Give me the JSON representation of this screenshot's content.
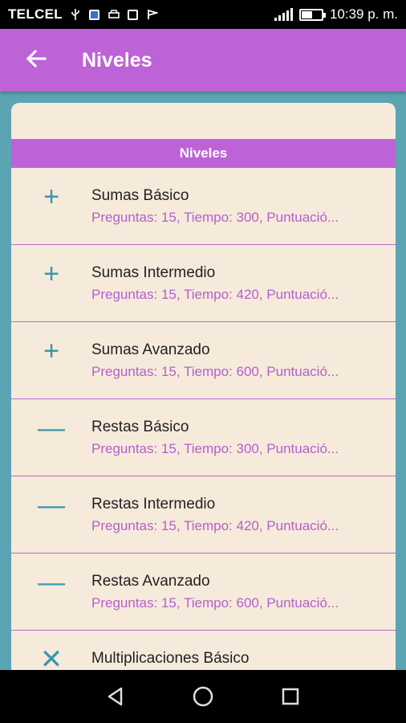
{
  "status_bar": {
    "carrier": "TELCEL",
    "time": "10:39 p. m.",
    "battery_level": 0.55
  },
  "app_bar": {
    "title": "Niveles",
    "back_icon": "arrow-back-icon"
  },
  "section": {
    "header": "Niveles"
  },
  "levels": [
    {
      "icon": "plus-icon",
      "glyph": "+",
      "title": "Sumas Básico",
      "subtitle": "Preguntas: 15, Tiempo: 300, Puntuació..."
    },
    {
      "icon": "plus-icon",
      "glyph": "+",
      "title": "Sumas Intermedio",
      "subtitle": "Preguntas: 15, Tiempo: 420, Puntuació..."
    },
    {
      "icon": "plus-icon",
      "glyph": "+",
      "title": "Sumas Avanzado",
      "subtitle": "Preguntas: 15, Tiempo: 600, Puntuació..."
    },
    {
      "icon": "minus-icon",
      "glyph": "—",
      "title": "Restas Básico",
      "subtitle": "Preguntas: 15, Tiempo: 300, Puntuació..."
    },
    {
      "icon": "minus-icon",
      "glyph": "—",
      "title": "Restas Intermedio",
      "subtitle": "Preguntas: 15, Tiempo: 420, Puntuació..."
    },
    {
      "icon": "minus-icon",
      "glyph": "—",
      "title": "Restas Avanzado",
      "subtitle": "Preguntas: 15, Tiempo: 600, Puntuació..."
    },
    {
      "icon": "multiply-icon",
      "glyph": "✕",
      "title": "Multiplicaciones Básico",
      "subtitle": ""
    }
  ],
  "nav_bar": {
    "back": "nav-back-icon",
    "home": "nav-home-icon",
    "recents": "nav-recents-icon"
  },
  "colors": {
    "accent": "#bd63d7",
    "background": "#5aa4b3",
    "card": "#f6eadb",
    "icon": "#3a97ad"
  }
}
